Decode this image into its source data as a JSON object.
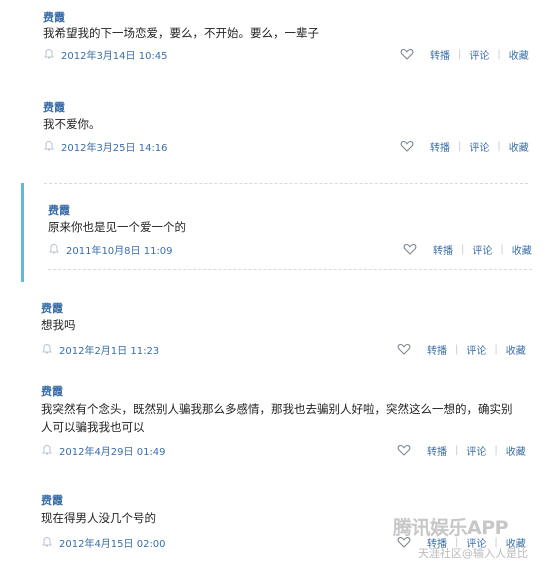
{
  "posts": [
    {
      "author": "费霞",
      "text": "我希望我的下一场恋爱，要么，不开始。要么，一辈子",
      "time": "2012年3月14日 10:45",
      "repost": "转播",
      "comment": "评论",
      "fav": "收藏"
    },
    {
      "author": "费霞",
      "text": "我不爱你。",
      "time": "2012年3月25日 14:16",
      "repost": "转播",
      "comment": "评论",
      "fav": "收藏"
    },
    {
      "author": "费霞",
      "text": "原来你也是见一个爱一个的",
      "time": "2011年10月8日 11:09",
      "repost": "转播",
      "comment": "评论",
      "fav": "收藏"
    },
    {
      "author": "费霞",
      "text": "想我吗",
      "time": "2012年2月1日 11:23",
      "repost": "转播",
      "comment": "评论",
      "fav": "收藏"
    },
    {
      "author": "费霞",
      "text": "我突然有个念头，既然别人骗我那么多感情，那我也去骗别人好啦，突然这么一想的，确实别",
      "text2": "人可以骗我我也可以",
      "time": "2012年4月29日 01:49",
      "repost": "转播",
      "comment": "评论",
      "fav": "收藏"
    },
    {
      "author": "费霞",
      "text": "现在得男人没几个号的",
      "time": "2012年4月15日 02:00",
      "repost": "转播",
      "comment": "评论",
      "fav": "收藏"
    }
  ],
  "watermark": {
    "line1": "腾讯娱乐APP",
    "line2": "天涯社区@输入人是比"
  },
  "colors": {
    "link": "#3a6ea8",
    "accent": "#66b7d6",
    "divider": "#d9d9d9"
  },
  "icons": {
    "time": "bell-icon",
    "like": "heart-icon"
  }
}
